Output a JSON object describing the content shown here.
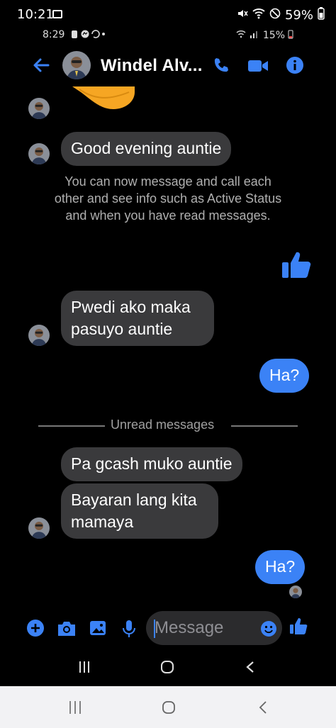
{
  "outer_status": {
    "time": "10:21",
    "battery": "59%"
  },
  "inner_status": {
    "time": "8:29",
    "battery": "15%"
  },
  "header": {
    "contact_name": "Windel Alv..."
  },
  "messages": {
    "m1": "Good evening auntie",
    "system_notice": "You can now message and call each other and see info such as Active Status and when you have read messages.",
    "m2": "Pwedi ako maka pasuyo auntie",
    "m3_mine": "Ha?",
    "divider": "Unread messages",
    "m4": "Pa gcash muko auntie",
    "m5": "Bayaran lang kita mamaya",
    "m6_mine": "Ha?"
  },
  "composer": {
    "placeholder": "Message"
  },
  "colors": {
    "accent": "#3b82f6",
    "bubble_other": "#3a3a3c",
    "background": "#000000"
  }
}
